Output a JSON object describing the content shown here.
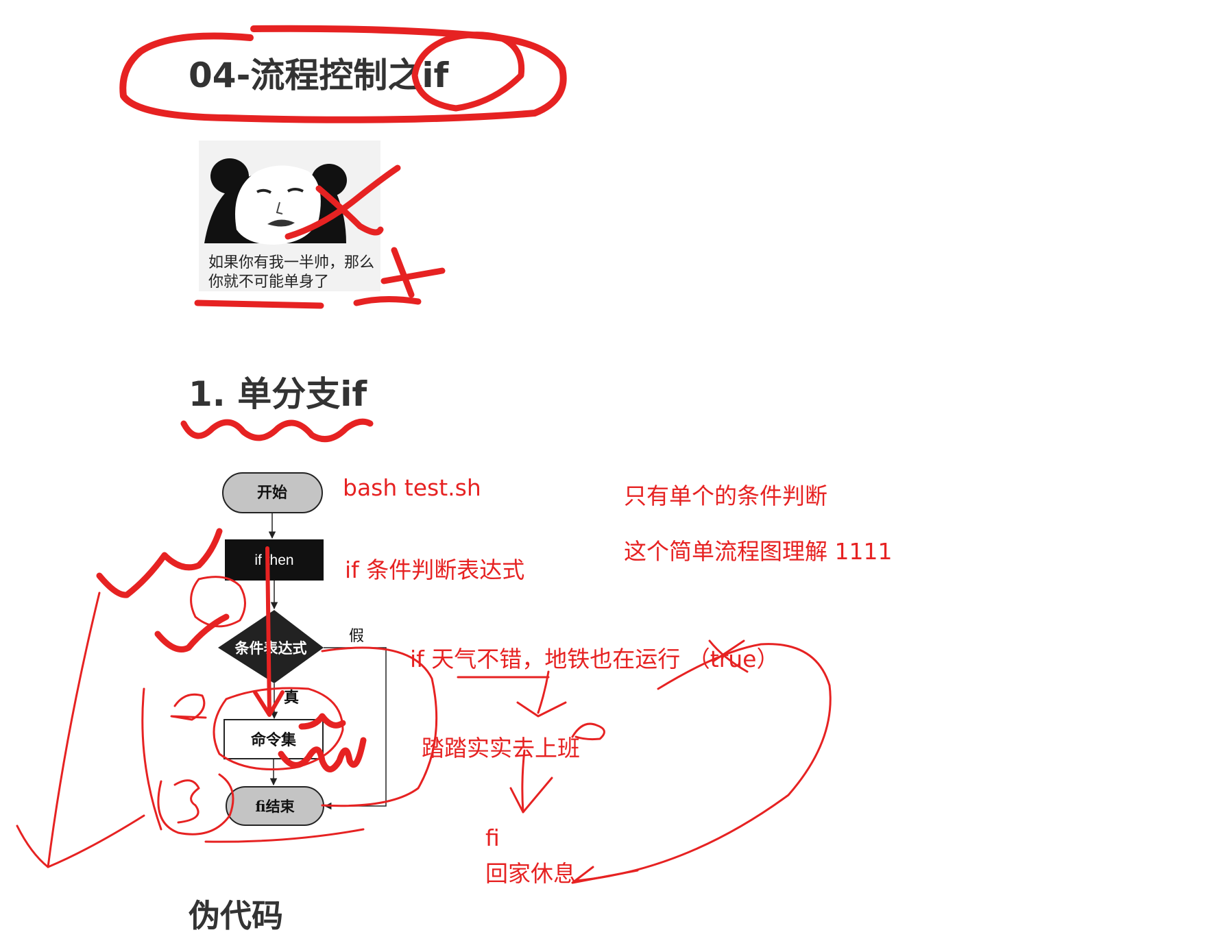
{
  "title": "04-流程控制之if",
  "meme": {
    "caption": "如果你有我一半帅，那么你就不可能单身了",
    "icon": "panda-face-icon"
  },
  "section1": {
    "heading": "1. 单分支if"
  },
  "flowchart": {
    "start": "开始",
    "if_then": "if then",
    "condition": "条件表达式",
    "false_label": "假",
    "true_label": "真",
    "commands": "命令集",
    "end": "fi结束"
  },
  "notes": {
    "bash_cmd": "bash  test.sh",
    "if_expr": "if  条件判断表达式",
    "single_condition": "只有单个的条件判断",
    "simple_flow": "这个简单流程图理解 1111",
    "example_if": "if   天气不错，地铁也在运行   （true）",
    "go_work": "踏踏实实去上班",
    "fi": "fi",
    "go_home": "回家休息"
  },
  "pseudo_heading": "伪代码",
  "colors": {
    "annotation_red": "#e62222",
    "heading_text": "#333333"
  }
}
